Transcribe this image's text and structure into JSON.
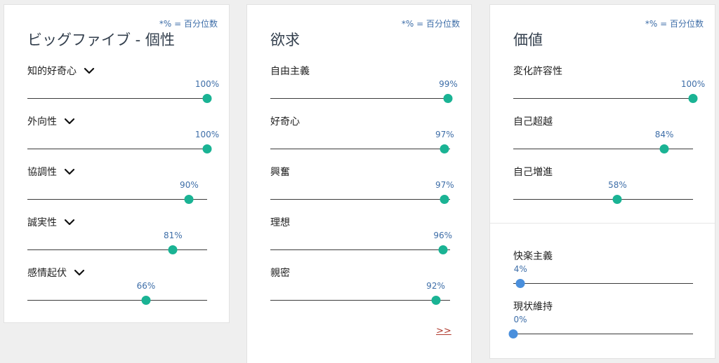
{
  "colors": {
    "accent_green": "#1ab394",
    "accent_blue": "#4a8fdc",
    "percent_text": "#3e6ea8",
    "link_red": "#b03a2e"
  },
  "big5": {
    "note": "*% = 百分位数",
    "title": "ビッグファイブ - 個性",
    "items": [
      {
        "label": "知的好奇心",
        "percent_text": "100%",
        "value": 100,
        "icon": "chevron-down-icon"
      },
      {
        "label": "外向性",
        "percent_text": "100%",
        "value": 100,
        "icon": "chevron-down-icon"
      },
      {
        "label": "協調性",
        "percent_text": "90%",
        "value": 90,
        "icon": "chevron-down-icon"
      },
      {
        "label": "誠実性",
        "percent_text": "81%",
        "value": 81,
        "icon": "chevron-down-icon"
      },
      {
        "label": "感情起伏",
        "percent_text": "66%",
        "value": 66,
        "icon": "chevron-down-icon"
      }
    ]
  },
  "needs": {
    "note": "*% = 百分位数",
    "title": "欲求",
    "items": [
      {
        "label": "自由主義",
        "percent_text": "99%",
        "value": 99
      },
      {
        "label": "好奇心",
        "percent_text": "97%",
        "value": 97
      },
      {
        "label": "興奮",
        "percent_text": "97%",
        "value": 97
      },
      {
        "label": "理想",
        "percent_text": "96%",
        "value": 96
      },
      {
        "label": "親密",
        "percent_text": "92%",
        "value": 92
      }
    ],
    "more_link": ">>"
  },
  "values": {
    "note": "*% = 百分位数",
    "title": "価値",
    "items": [
      {
        "label": "変化許容性",
        "percent_text": "100%",
        "value": 100
      },
      {
        "label": "自己超越",
        "percent_text": "84%",
        "value": 84
      },
      {
        "label": "自己増進",
        "percent_text": "58%",
        "value": 58
      }
    ],
    "low_items": [
      {
        "label": "快楽主義",
        "percent_text": "4%",
        "value": 4
      },
      {
        "label": "現状維持",
        "percent_text": "0%",
        "value": 0
      }
    ]
  }
}
